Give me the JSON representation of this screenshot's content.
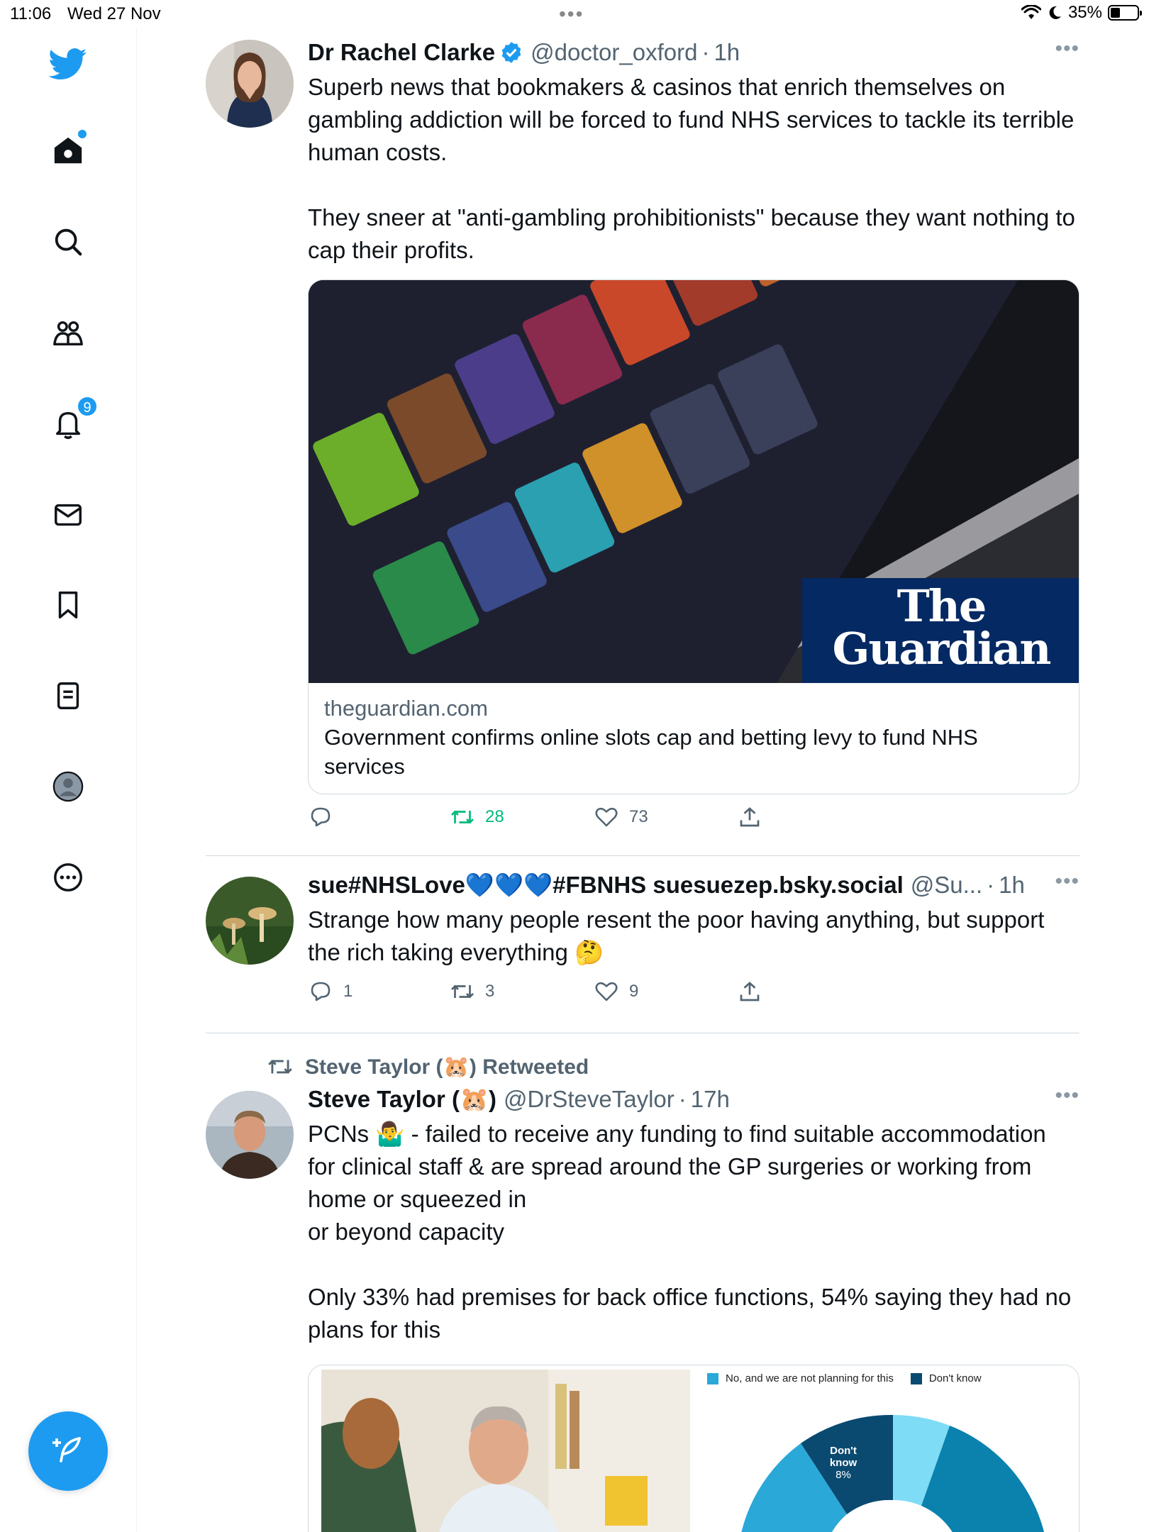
{
  "status_bar": {
    "time": "11:06",
    "date": "Wed 27 Nov",
    "battery": "35%",
    "battery_level": 0.35
  },
  "sidebar": {
    "items": [
      {
        "name": "home",
        "icon": "home-icon"
      },
      {
        "name": "search",
        "icon": "search-icon"
      },
      {
        "name": "communities",
        "icon": "communities-icon"
      },
      {
        "name": "notifications",
        "icon": "bell-icon",
        "badge": "9"
      },
      {
        "name": "messages",
        "icon": "mail-icon"
      },
      {
        "name": "bookmarks",
        "icon": "bookmark-icon"
      },
      {
        "name": "lists",
        "icon": "list-icon"
      },
      {
        "name": "profile",
        "icon": "profile-icon"
      },
      {
        "name": "more",
        "icon": "more-circle-icon"
      }
    ],
    "compose_icon": "compose-icon"
  },
  "tweets": [
    {
      "name": "Dr Rachel Clarke",
      "handle": "@doctor_oxford",
      "time": "1h",
      "text": "Superb news that bookmakers & casinos that enrich themselves on gambling addiction will be forced to fund NHS services to tackle its terrible human costs.\n\nThey sneer at \"anti-gambling prohibitionists\" because they want nothing to cap their profits.",
      "card": {
        "brand_line1": "The",
        "brand_line2": "Guardian",
        "domain": "theguardian.com",
        "title": "Government confirms online slots cap and betting levy to fund NHS services"
      },
      "replies": "",
      "retweets": "28",
      "likes": "73"
    },
    {
      "name": "sue#NHSLove💙💙💙#FBNHS suesuezep.bsky.social",
      "handle": "@Su...",
      "time": "1h",
      "text": "Strange how many people resent the poor having anything, but support the rich taking everything 🤔",
      "replies": "1",
      "retweets": "3",
      "likes": "9"
    },
    {
      "retweeted_by": "Steve Taylor (🐹) Retweeted",
      "name": "Steve Taylor (🐹)",
      "handle": "@DrSteveTaylor",
      "time": "17h",
      "text": "PCNs 🤷‍♂️ - failed to receive any funding to find suitable accommodation for clinical staff & are spread around the GP surgeries or working from home or squeezed in\nor beyond capacity\n\nOnly 33% had premises for back office functions, 54% saying they had no plans for this",
      "chart": {
        "legend_1": "No, and we are not planning for this",
        "legend_2": "Don't know",
        "slice_label": "Don't know",
        "slice_value": "8%"
      }
    }
  ],
  "colors": {
    "accent": "#1d9bf0",
    "retweet_green": "#00ba7c",
    "guardian_blue": "#052962"
  }
}
